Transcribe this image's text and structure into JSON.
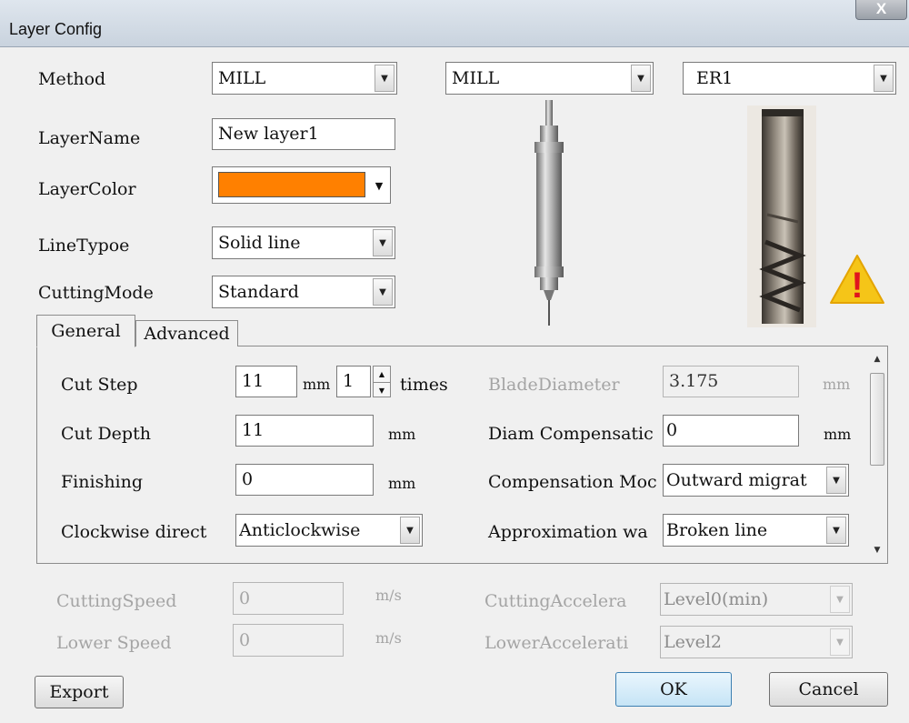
{
  "window": {
    "title": "Layer Config",
    "close_icon": "X"
  },
  "method": {
    "label": "Method",
    "combo1": "MILL",
    "combo2": "MILL",
    "combo3": "ER1"
  },
  "layer_name": {
    "label": "LayerName",
    "value": "New layer1"
  },
  "layer_color": {
    "label": "LayerColor",
    "color": "#ff8000"
  },
  "line_type": {
    "label": "LineTypoe",
    "value": "Solid line"
  },
  "cutting_mode": {
    "label": "CuttingMode",
    "value": "Standard"
  },
  "tabs": [
    {
      "label": "General",
      "active": true
    },
    {
      "label": "Advanced",
      "active": false
    }
  ],
  "general": {
    "cut_step": {
      "label": "Cut Step",
      "value": "11",
      "unit": "mm",
      "times_value": "1",
      "times_label": "times"
    },
    "cut_depth": {
      "label": "Cut Depth",
      "value": "11",
      "unit": "mm"
    },
    "finishing": {
      "label": "Finishing",
      "value": "0",
      "unit": "mm"
    },
    "clockwise": {
      "label": "Clockwise direct",
      "value": "Anticlockwise"
    },
    "blade_diameter": {
      "label": "BladeDiameter",
      "value": "3.175",
      "unit": "mm"
    },
    "diam_comp": {
      "label": "Diam Compensatic",
      "value": "0",
      "unit": "mm"
    },
    "comp_mode": {
      "label": "Compensation Moc",
      "value": "Outward migrat"
    },
    "approx": {
      "label": "Approximation wa",
      "value": "Broken line"
    }
  },
  "cutting_speed": {
    "label": "CuttingSpeed",
    "value": "0",
    "unit": "m/s"
  },
  "lower_speed": {
    "label": "Lower Speed",
    "value": "0",
    "unit": "m/s"
  },
  "cutting_accel": {
    "label": "CuttingAccelera",
    "value": "Level0(min)"
  },
  "lower_accel": {
    "label": "LowerAccelerati",
    "value": "Level2"
  },
  "buttons": {
    "export": "Export",
    "ok": "OK",
    "cancel": "Cancel"
  },
  "icons": {
    "dropdown": "▼",
    "scroll_up": "▲",
    "scroll_down": "▼",
    "spin_up": "▲",
    "spin_down": "▼",
    "warning": "!"
  },
  "colors": {
    "warning": "#f5c518",
    "warning_mark": "#e0141e",
    "ok_border": "#3c7fb1"
  }
}
